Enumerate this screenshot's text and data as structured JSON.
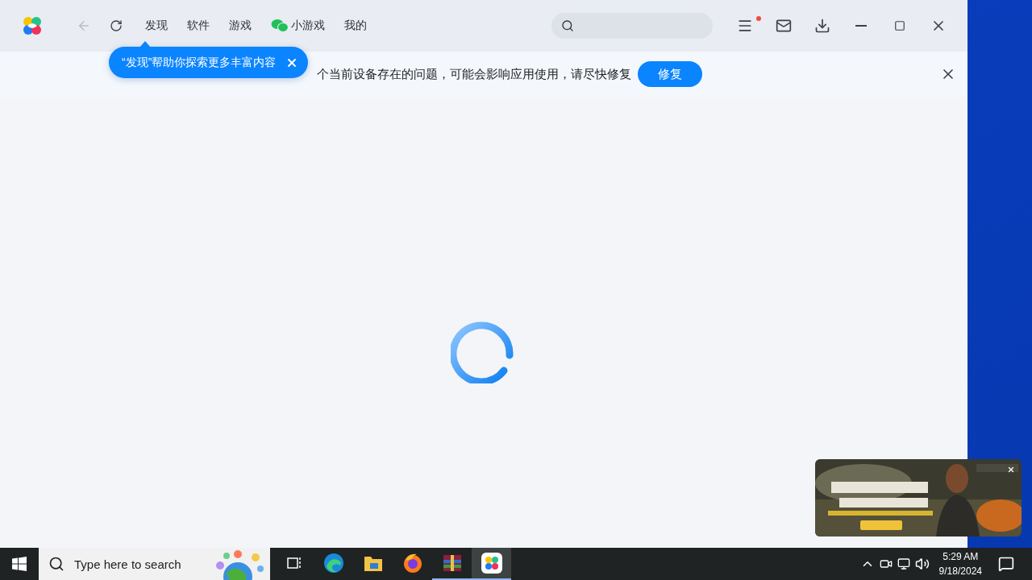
{
  "app": {
    "nav": {
      "tabs": [
        {
          "label": "发现",
          "kind": "text"
        },
        {
          "label": "软件",
          "kind": "text"
        },
        {
          "label": "游戏",
          "kind": "text"
        },
        {
          "label": "小游戏",
          "kind": "wechat"
        },
        {
          "label": "我的",
          "kind": "text"
        }
      ]
    },
    "menu_notification": true,
    "notice": {
      "text": "个当前设备存在的问题，可能会影响应用使用，请尽快修复",
      "button": "修复"
    },
    "tooltip": {
      "text": "“发现”帮助你探索更多丰富内容"
    }
  },
  "taskbar": {
    "search_placeholder": "Type here to search",
    "apps": [
      {
        "kind": "taskview",
        "running": false,
        "selected": false
      },
      {
        "kind": "edge",
        "running": false,
        "selected": false
      },
      {
        "kind": "files",
        "running": false,
        "selected": false
      },
      {
        "kind": "firefox",
        "running": false,
        "selected": false
      },
      {
        "kind": "archive",
        "running": true,
        "selected": false
      },
      {
        "kind": "store",
        "running": true,
        "selected": true
      }
    ],
    "time": "5:29 AM",
    "date": "9/18/2024"
  }
}
